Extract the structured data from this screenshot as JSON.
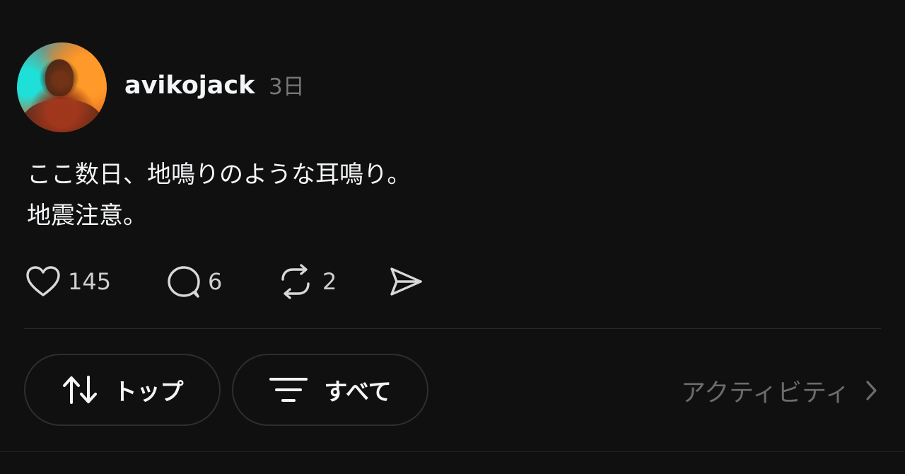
{
  "post": {
    "username": "avikojack",
    "time": "3日",
    "line1": "ここ数日、地鳴りのような耳鳴り。",
    "line2": "地震注意。"
  },
  "actions": {
    "likes": "145",
    "comments": "6",
    "reposts": "2"
  },
  "filters": {
    "top_label": "トップ",
    "all_label": "すべて",
    "activity_label": "アクティビティ"
  },
  "icons": [
    "heart-icon",
    "comment-icon",
    "repost-icon",
    "share-icon",
    "sort-icon",
    "filter-icon",
    "chevron-right-icon"
  ],
  "colors": {
    "background": "#101010",
    "text": "#f3f5f7",
    "muted": "#777777"
  }
}
